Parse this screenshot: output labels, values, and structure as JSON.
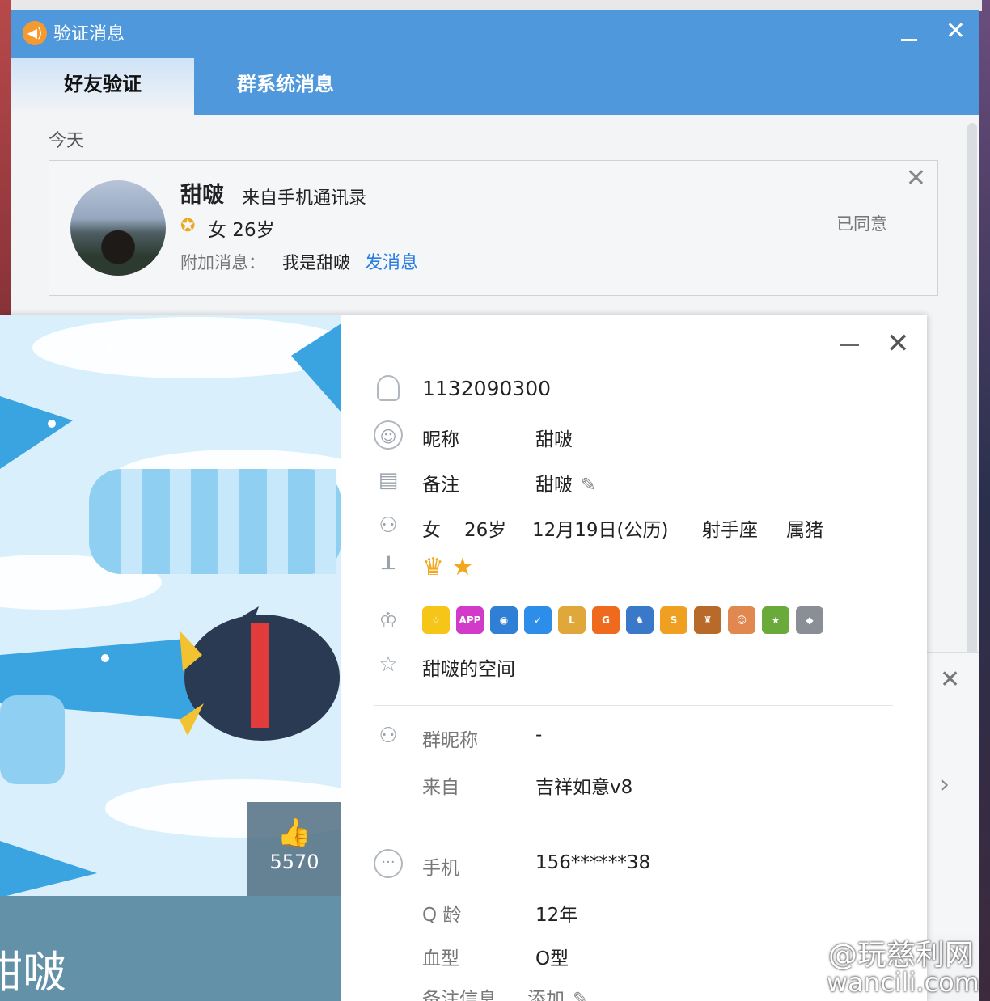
{
  "verify_window": {
    "title": "验证消息",
    "logo_icon": "speaker-icon",
    "tabs": [
      {
        "label": "好友验证",
        "active": true
      },
      {
        "label": "群系统消息",
        "active": false
      }
    ],
    "section_today": "今天",
    "request": {
      "name": "甜啵",
      "source": "来自手机通讯录",
      "gender_age": "女 26岁",
      "message_label": "附加消息：",
      "message": "我是甜啵",
      "send_link": "发消息",
      "status": "已同意"
    }
  },
  "profile": {
    "likes": "5570",
    "display_name": "甜啵",
    "qq_number": "1132090300",
    "nickname_label": "昵称",
    "nickname": "甜啵",
    "remark_label": "备注",
    "remark": "甜啵",
    "gender": "女",
    "age": "26岁",
    "birthday": "12月19日(公历)",
    "zodiac": "射手座",
    "chinese_zodiac": "属猪",
    "level_icons": [
      "crown-icon",
      "star-icon"
    ],
    "service_badges": [
      {
        "name": "vip-star-badge",
        "text": "☆",
        "color": "#f5c518"
      },
      {
        "name": "app-badge",
        "text": "APP",
        "color": "#d23bc9"
      },
      {
        "name": "camera-badge",
        "text": "◉",
        "color": "#2f7fd6"
      },
      {
        "name": "shield-badge",
        "text": "✓",
        "color": "#2c8ee8"
      },
      {
        "name": "book-badge",
        "text": "L",
        "color": "#e0a83a"
      },
      {
        "name": "g-badge",
        "text": "G",
        "color": "#f06a1e"
      },
      {
        "name": "penguin-badge",
        "text": "♞",
        "color": "#3a78c9"
      },
      {
        "name": "coin-badge",
        "text": "S",
        "color": "#f0a020"
      },
      {
        "name": "game-badge",
        "text": "♜",
        "color": "#b86a2a"
      },
      {
        "name": "face-badge",
        "text": "☺",
        "color": "#e08850"
      },
      {
        "name": "hero-badge",
        "text": "★",
        "color": "#6aaa3a"
      },
      {
        "name": "diamond-badge",
        "text": "◆",
        "color": "#8a8f96"
      }
    ],
    "space_link": "甜啵的空间",
    "group_nick_label": "群昵称",
    "group_nick": "-",
    "from_label": "来自",
    "from": "吉祥如意v8",
    "phone_label": "手机",
    "phone": "156******38",
    "qage_label": "Q 龄",
    "qage": "12年",
    "blood_label": "血型",
    "blood": "O型",
    "remark_info_label": "备注信息",
    "remark_info_add": "添加"
  },
  "watermark": {
    "line1": "@玩慈利网",
    "line2": "wancili.com"
  }
}
